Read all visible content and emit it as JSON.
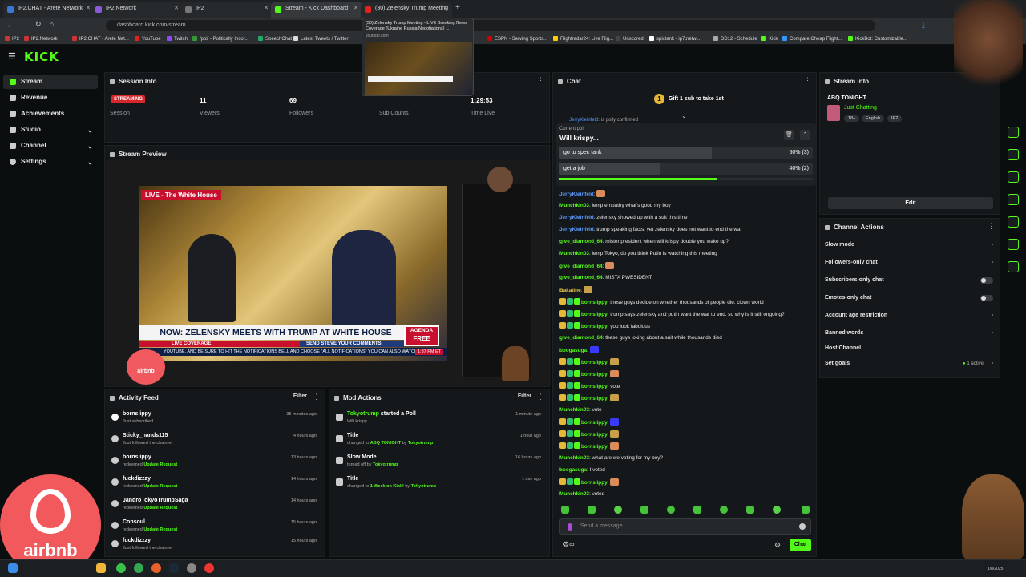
{
  "browser": {
    "tabs": [
      {
        "label": "IP2.CHAT - Arete Network"
      },
      {
        "label": "IP2.Network"
      },
      {
        "label": "IP2"
      },
      {
        "label": "Stream - Kick Dashboard"
      },
      {
        "label": "(30) Zelensky Trump Meeting"
      }
    ],
    "url": "dashboard.kick.com/stream",
    "tooltip_title": "(30) Zelensky Trump Meeting - LIVE Breaking News Coverage (Ukraine Russia Negotiations) ...",
    "tooltip_domain": "youtube.com",
    "bookmarks": [
      "IP2",
      "IP2.Network",
      "IP2.CHAT - Arete Net...",
      "YouTube",
      "Twitch",
      "/pol/ - Politically Incor...",
      "SpeechChat",
      "Latest Tweets / Twitter",
      "ESPN - Serving Sports...",
      "Flightradar24: Live Flig...",
      "Unscored",
      "spictank - ip7.netw...",
      "DD12 - Schedule",
      "Kick",
      "Compare Cheap Flight...",
      "KickBot: Customizable..."
    ]
  },
  "brand": {
    "logo": "KICK",
    "accent": "#53fc18"
  },
  "sidebar": {
    "items": [
      {
        "label": "Stream"
      },
      {
        "label": "Revenue"
      },
      {
        "label": "Achievements"
      },
      {
        "label": "Studio"
      },
      {
        "label": "Channel"
      },
      {
        "label": "Settings"
      }
    ]
  },
  "session": {
    "title": "Session Info",
    "status": "STREAMING",
    "session_label": "Session",
    "viewers": "11",
    "viewers_label": "Viewers",
    "followers": "69",
    "followers_label": "Followers",
    "subs_label": "Sub Counts",
    "time": "1:29:53",
    "time_label": "Time Live"
  },
  "preview": {
    "title": "Stream Preview",
    "live_banner": "LIVE - The White House",
    "headline": "NOW: ZELENSKY MEETS WITH TRUMP AT WHITE HOUSE",
    "live_coverage": "LIVE COVERAGE",
    "send_comments": "SEND STEVE YOUR COMMENTS",
    "agenda": "AGENDA",
    "free": "FREE",
    "ticker": "YOUTUBE, AND BE SURE TO HIT THE NOTIFICATIONS BELL AND CHOOSE \"ALL NOTIFICATIONS\"   YOU CAN ALSO WATCH",
    "clock": "1:37 PM ET",
    "airbnb": "airbnb"
  },
  "activity": {
    "title": "Activity Feed",
    "filter": "Filter",
    "items": [
      {
        "name": "bornslippy",
        "sub": "Just subscribed",
        "link": "",
        "time": "35 minutes ago"
      },
      {
        "name": "Sticky_hands115",
        "sub": "Just followed the channel",
        "link": "",
        "time": "4 hours ago"
      },
      {
        "name": "bornslippy",
        "sub": "redeemed",
        "link": "Update Request",
        "time": "13 hours ago"
      },
      {
        "name": "fuckdizzzy",
        "sub": "redeemed",
        "link": "Update Request",
        "time": "14 hours ago"
      },
      {
        "name": "JandroTokyoTrumpSaga",
        "sub": "redeemed",
        "link": "Update Request",
        "time": "14 hours ago"
      },
      {
        "name": "Consoul",
        "sub": "redeemed",
        "link": "Update Request",
        "time": "15 hours ago"
      },
      {
        "name": "fuckdizzzy",
        "sub": "Just followed the channel",
        "link": "",
        "time": "15 hours ago"
      }
    ]
  },
  "mod": {
    "title": "Mod Actions",
    "filter": "Filter",
    "items": [
      {
        "name": "Tokyotrump",
        "action": "started a Poll",
        "sub": "Will krispy...",
        "by": "",
        "link": "",
        "time": "1 minute ago"
      },
      {
        "name": "Title",
        "action": "",
        "sub": "changed to",
        "link": "ABQ TONIGHT",
        "by": "Tokyotrump",
        "time": "1 hour ago"
      },
      {
        "name": "Slow Mode",
        "action": "",
        "sub": "turned off by",
        "link": "",
        "by": "Tokyotrump",
        "time": "16 hours ago"
      },
      {
        "name": "Title",
        "action": "",
        "sub": "changed to",
        "link": "1 Week on Kick!",
        "by": "Tokyotrump",
        "time": "1 day ago"
      }
    ]
  },
  "chat": {
    "title": "Chat",
    "gift": "Gift 1 sub to take 1st",
    "pinned_partial": "is polly confirmed",
    "poll": {
      "label": "Current poll",
      "question": "Will krispy...",
      "options": [
        {
          "text": "go to spec tank",
          "pct": 60,
          "display": "60% (3)"
        },
        {
          "text": "get a job",
          "pct": 40,
          "display": "40% (2)"
        }
      ],
      "time_remaining_fraction": 0.62
    },
    "messages": [
      {
        "user": "JerryKleinfeld",
        "color": "blue",
        "text": ""
      },
      {
        "user": "Munchkin03",
        "color": "green",
        "text": "lemp empathy what's good my boy"
      },
      {
        "user": "JerryKleinfeld",
        "color": "blue",
        "text": "zelensky showed up with a suit this time"
      },
      {
        "user": "JerryKleinfeld",
        "color": "blue",
        "text": "trump speaking facts. yet zelensky does not want to end the war"
      },
      {
        "user": "give_diamond_64",
        "color": "green",
        "text": "mister president when will krispy double you wake up?"
      },
      {
        "user": "Munchkin03",
        "color": "green",
        "text": "lemp Tokyo, do you think Putin is watching this meeting"
      },
      {
        "user": "give_diamond_64",
        "color": "green",
        "text": ""
      },
      {
        "user": "give_diamond_64",
        "color": "green",
        "text": "MISTA PWESIDENT"
      },
      {
        "user": "Bakatine",
        "color": "yellow",
        "text": ""
      },
      {
        "user": "bornslippy",
        "color": "green",
        "text": "these guys decide on whether thousands of people die. clown world"
      },
      {
        "user": "bornslippy",
        "color": "green",
        "text": "trump says zelensky and putin want the war to end. so why is it still ongoing?"
      },
      {
        "user": "bornslippy",
        "color": "green",
        "text": "you look fabulous"
      },
      {
        "user": "give_diamond_64",
        "color": "green",
        "text": "these guys joking about a suit while thousands died"
      },
      {
        "user": "boogasuga",
        "color": "green",
        "text": ""
      },
      {
        "user": "bornslippy",
        "color": "green",
        "text": ""
      },
      {
        "user": "bornslippy",
        "color": "green",
        "text": ""
      },
      {
        "user": "bornslippy",
        "color": "green",
        "text": "vote"
      },
      {
        "user": "bornslippy",
        "color": "green",
        "text": ""
      },
      {
        "user": "Munchkin03",
        "color": "green",
        "text": "vote"
      },
      {
        "user": "bornslippy",
        "color": "green",
        "text": ""
      },
      {
        "user": "bornslippy",
        "color": "green",
        "text": ""
      },
      {
        "user": "bornslippy",
        "color": "green",
        "text": ""
      },
      {
        "user": "Munchkin03",
        "color": "green",
        "text": "what are we voting for my boy?"
      },
      {
        "user": "boogasuga",
        "color": "green",
        "text": "I voted"
      },
      {
        "user": "bornslippy",
        "color": "green",
        "text": ""
      },
      {
        "user": "Munchkin03",
        "color": "green",
        "text": "voted"
      }
    ],
    "placeholder": "Send a message",
    "send": "Chat"
  },
  "stream_info": {
    "title": "Stream info",
    "stream_title": "ABQ TONIGHT",
    "category": "Just Chatting",
    "tags": [
      "18+",
      "English",
      "IP2"
    ],
    "edit": "Edit"
  },
  "channel_actions": {
    "title": "Channel Actions",
    "rows": [
      {
        "label": "Slow mode",
        "control": "arrow"
      },
      {
        "label": "Followers-only chat",
        "control": "arrow"
      },
      {
        "label": "Subscribers-only chat",
        "control": "toggle"
      },
      {
        "label": "Emotes-only chat",
        "control": "toggle"
      },
      {
        "label": "Account age restriction",
        "control": "arrow"
      },
      {
        "label": "Banned words",
        "control": "arrow"
      },
      {
        "label": "Host Channel",
        "control": "none"
      },
      {
        "label": "Set goals",
        "control": "arrow"
      }
    ],
    "goals_status": "1 active"
  },
  "overlay": {
    "airbnb": "airbnb"
  },
  "taskbar": {
    "date": "1/8/2025"
  }
}
